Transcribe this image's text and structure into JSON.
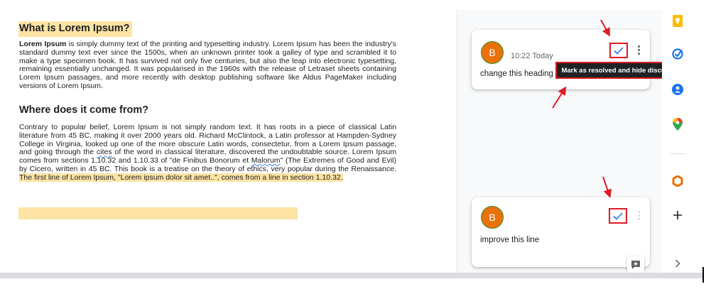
{
  "document": {
    "heading1": "What is Lorem Ipsum?",
    "p1_bold": "Lorem Ipsum",
    "p1_text": " is simply dummy text of the printing and typesetting industry. Lorem Ipsum has been the industry's standard dummy text ever since the 1500s, when an unknown printer took a galley of type and scrambled it to make a type specimen book. It has survived not only five centuries, but also the leap into electronic typesetting, remaining essentially unchanged. It was popularised in the 1960s with the release of Letraset sheets containing Lorem Ipsum passages, and more recently with desktop publishing software like Aldus PageMaker including versions of Lorem Ipsum.",
    "heading2": "Where does it come from?",
    "p2_a": "Contrary to popular belief, Lorem Ipsum is not simply random text. It has roots in a piece of classical Latin literature from 45 BC, making it over 2000 years old. Richard McClintock, a Latin professor at Hampden-Sydney College in Virginia, looked up one of the more obscure Latin words, consectetur, from a Lorem Ipsum passage, and going through the ",
    "p2_cites": "cites",
    "p2_b": " of the word in classical literature, discovered the undoubtable source. Lorem Ipsum comes from sections 1.10.32 and 1.10.33 of \"de Finibus Bonorum et ",
    "p2_malorum": "Malorum",
    "p2_c": "\" (The Extremes of Good and Evil) by Cicero, written in 45 BC. This book is a treatise on the theory of ethics, very popular during the Renaissance. ",
    "p2_highlight": "The first line of Lorem Ipsum, \"Lorem ipsum dolor sit amet..\", comes from a line in section 1.10.32."
  },
  "comments": [
    {
      "avatar_letter": "B",
      "time": "10:22 Today",
      "text": "change this heading",
      "resolve_icon": "check-icon"
    },
    {
      "avatar_letter": "B",
      "text": "improve this line",
      "resolve_icon": "check-icon"
    }
  ],
  "tooltip": "Mark as resolved and hide discussion",
  "side_panel": [
    "keep-icon",
    "tasks-icon",
    "contacts-icon",
    "maps-icon",
    "office-addon-icon",
    "add-icon",
    "expand-icon"
  ],
  "colors": {
    "highlight": "#fde3a4",
    "avatar": "#e8710a",
    "annotation_red": "#e01b24",
    "accent_blue": "#1a73e8"
  }
}
